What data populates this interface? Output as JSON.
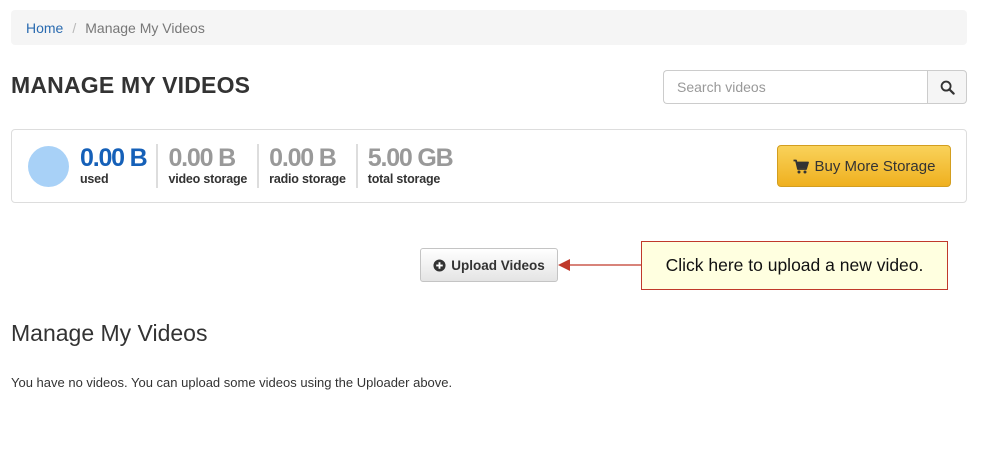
{
  "breadcrumb": {
    "home": "Home",
    "separator": "/",
    "current": "Manage My Videos"
  },
  "header": {
    "title": "MANAGE MY VIDEOS"
  },
  "search": {
    "placeholder": "Search videos",
    "value": "",
    "icon": "search-icon"
  },
  "storage": {
    "used": {
      "value": "0.00 B",
      "label": "used"
    },
    "video": {
      "value": "0.00 B",
      "label": "video storage"
    },
    "radio": {
      "value": "0.00 B",
      "label": "radio storage"
    },
    "total": {
      "value": "5.00 GB",
      "label": "total storage"
    },
    "buy_label": "Buy More Storage",
    "buy_icon": "cart-icon"
  },
  "upload": {
    "label": "Upload Videos",
    "icon": "plus-circle-icon"
  },
  "callout": {
    "text": "Click here to upload a new video."
  },
  "section": {
    "title": "Manage My Videos",
    "empty_message": "You have no videos. You can upload some videos using the Uploader above."
  },
  "colors": {
    "link": "#2a6bb0",
    "used_value": "#1560b8",
    "muted_value": "#999999",
    "usage_circle": "#a8d1f7",
    "buy_button": "#f0b429",
    "callout_border": "#c0392b",
    "callout_bg": "#ffffe0"
  }
}
